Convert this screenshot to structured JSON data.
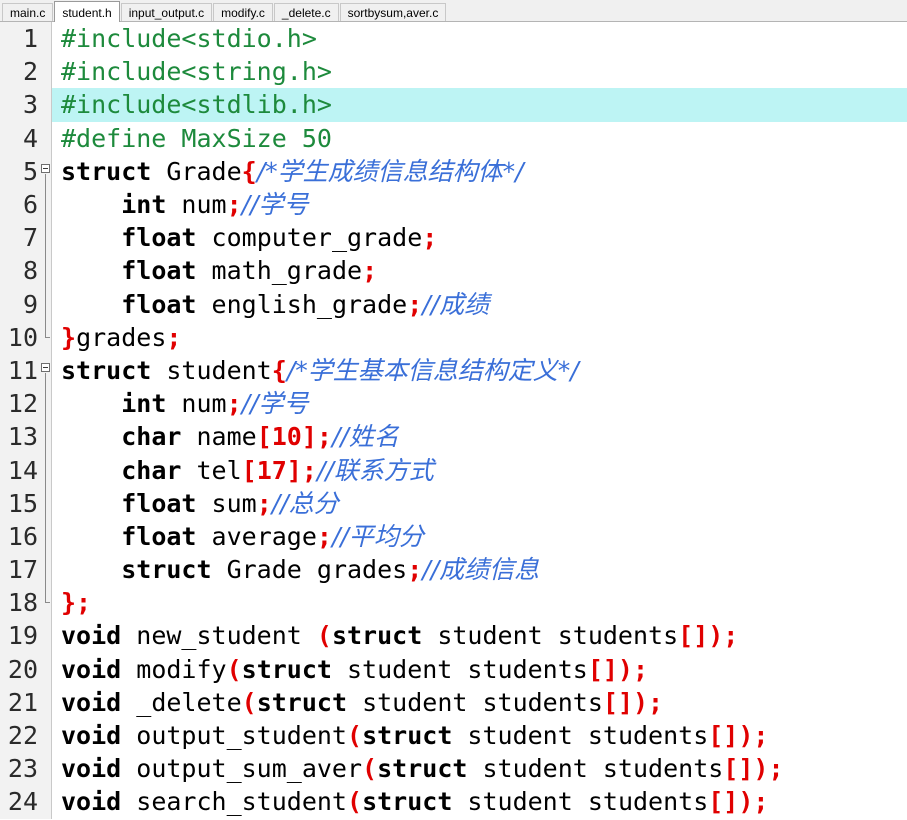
{
  "tabs": [
    {
      "label": "main.c",
      "active": false
    },
    {
      "label": "student.h",
      "active": true
    },
    {
      "label": "input_output.c",
      "active": false
    },
    {
      "label": "modify.c",
      "active": false
    },
    {
      "label": "_delete.c",
      "active": false
    },
    {
      "label": "sortbysum,aver.c",
      "active": false
    }
  ],
  "colors": {
    "preprocessor": "#1d8a3c",
    "keyword": "#000000",
    "punctuation": "#e00000",
    "comment": "#3a6fd8",
    "identifier": "#000000",
    "current_line_highlight": "#bdf4f4",
    "gutter_background": "#f2f2f2",
    "tabbar_background": "#f0f0f0",
    "editor_background": "#ffffff"
  },
  "editor": {
    "current_line": 3,
    "fold_regions": [
      {
        "start": 5,
        "end": 10
      },
      {
        "start": 11,
        "end": 18
      }
    ],
    "lines": [
      {
        "n": "1",
        "tokens": [
          {
            "t": "#include<stdio.h>",
            "c": "pp"
          }
        ]
      },
      {
        "n": "2",
        "tokens": [
          {
            "t": "#include<string.h>",
            "c": "pp"
          }
        ]
      },
      {
        "n": "3",
        "tokens": [
          {
            "t": "#include<stdlib.h>",
            "c": "pp"
          }
        ]
      },
      {
        "n": "4",
        "tokens": [
          {
            "t": "#define MaxSize 50",
            "c": "pp"
          }
        ]
      },
      {
        "n": "5",
        "tokens": [
          {
            "t": "struct",
            "c": "kw"
          },
          {
            "t": " Grade",
            "c": "id"
          },
          {
            "t": "{",
            "c": "pun"
          },
          {
            "t": "/*学生成绩信息结构体*/",
            "c": "cm cjk"
          }
        ]
      },
      {
        "n": "6",
        "tokens": [
          {
            "t": "    ",
            "c": "id"
          },
          {
            "t": "int",
            "c": "kw"
          },
          {
            "t": " num",
            "c": "id"
          },
          {
            "t": ";",
            "c": "pun"
          },
          {
            "t": "//学号",
            "c": "cm cjk"
          }
        ]
      },
      {
        "n": "7",
        "tokens": [
          {
            "t": "    ",
            "c": "id"
          },
          {
            "t": "float",
            "c": "kw"
          },
          {
            "t": " computer_grade",
            "c": "id"
          },
          {
            "t": ";",
            "c": "pun"
          }
        ]
      },
      {
        "n": "8",
        "tokens": [
          {
            "t": "    ",
            "c": "id"
          },
          {
            "t": "float",
            "c": "kw"
          },
          {
            "t": " math_grade",
            "c": "id"
          },
          {
            "t": ";",
            "c": "pun"
          }
        ]
      },
      {
        "n": "9",
        "tokens": [
          {
            "t": "    ",
            "c": "id"
          },
          {
            "t": "float",
            "c": "kw"
          },
          {
            "t": " english_grade",
            "c": "id"
          },
          {
            "t": ";",
            "c": "pun"
          },
          {
            "t": "//成绩",
            "c": "cm cjk"
          }
        ]
      },
      {
        "n": "10",
        "tokens": [
          {
            "t": "}",
            "c": "pun"
          },
          {
            "t": "grades",
            "c": "id"
          },
          {
            "t": ";",
            "c": "pun"
          }
        ]
      },
      {
        "n": "11",
        "tokens": [
          {
            "t": "struct",
            "c": "kw"
          },
          {
            "t": " student",
            "c": "id"
          },
          {
            "t": "{",
            "c": "pun"
          },
          {
            "t": "/*学生基本信息结构定义*/",
            "c": "cm cjk"
          }
        ]
      },
      {
        "n": "12",
        "tokens": [
          {
            "t": "    ",
            "c": "id"
          },
          {
            "t": "int",
            "c": "kw"
          },
          {
            "t": " num",
            "c": "id"
          },
          {
            "t": ";",
            "c": "pun"
          },
          {
            "t": "//学号",
            "c": "cm cjk"
          }
        ]
      },
      {
        "n": "13",
        "tokens": [
          {
            "t": "    ",
            "c": "id"
          },
          {
            "t": "char",
            "c": "kw"
          },
          {
            "t": " name",
            "c": "id"
          },
          {
            "t": "[10]",
            "c": "pun"
          },
          {
            "t": ";",
            "c": "pun"
          },
          {
            "t": "//姓名",
            "c": "cm cjk"
          }
        ]
      },
      {
        "n": "14",
        "tokens": [
          {
            "t": "    ",
            "c": "id"
          },
          {
            "t": "char",
            "c": "kw"
          },
          {
            "t": " tel",
            "c": "id"
          },
          {
            "t": "[17]",
            "c": "pun"
          },
          {
            "t": ";",
            "c": "pun"
          },
          {
            "t": "//联系方式",
            "c": "cm cjk"
          }
        ]
      },
      {
        "n": "15",
        "tokens": [
          {
            "t": "    ",
            "c": "id"
          },
          {
            "t": "float",
            "c": "kw"
          },
          {
            "t": " sum",
            "c": "id"
          },
          {
            "t": ";",
            "c": "pun"
          },
          {
            "t": "//总分",
            "c": "cm cjk"
          }
        ]
      },
      {
        "n": "16",
        "tokens": [
          {
            "t": "    ",
            "c": "id"
          },
          {
            "t": "float",
            "c": "kw"
          },
          {
            "t": " average",
            "c": "id"
          },
          {
            "t": ";",
            "c": "pun"
          },
          {
            "t": "//平均分",
            "c": "cm cjk"
          }
        ]
      },
      {
        "n": "17",
        "tokens": [
          {
            "t": "    ",
            "c": "id"
          },
          {
            "t": "struct",
            "c": "kw"
          },
          {
            "t": " Grade grades",
            "c": "id"
          },
          {
            "t": ";",
            "c": "pun"
          },
          {
            "t": "//成绩信息",
            "c": "cm cjk"
          }
        ]
      },
      {
        "n": "18",
        "tokens": [
          {
            "t": "};",
            "c": "pun"
          }
        ]
      },
      {
        "n": "19",
        "tokens": [
          {
            "t": "void",
            "c": "kw"
          },
          {
            "t": " new_student ",
            "c": "id"
          },
          {
            "t": "(",
            "c": "pun"
          },
          {
            "t": "struct",
            "c": "kw"
          },
          {
            "t": " student students",
            "c": "id"
          },
          {
            "t": "[]);",
            "c": "pun"
          }
        ]
      },
      {
        "n": "20",
        "tokens": [
          {
            "t": "void",
            "c": "kw"
          },
          {
            "t": " modify",
            "c": "id"
          },
          {
            "t": "(",
            "c": "pun"
          },
          {
            "t": "struct",
            "c": "kw"
          },
          {
            "t": " student students",
            "c": "id"
          },
          {
            "t": "[]);",
            "c": "pun"
          }
        ]
      },
      {
        "n": "21",
        "tokens": [
          {
            "t": "void",
            "c": "kw"
          },
          {
            "t": " _delete",
            "c": "id"
          },
          {
            "t": "(",
            "c": "pun"
          },
          {
            "t": "struct",
            "c": "kw"
          },
          {
            "t": " student students",
            "c": "id"
          },
          {
            "t": "[]);",
            "c": "pun"
          }
        ]
      },
      {
        "n": "22",
        "tokens": [
          {
            "t": "void",
            "c": "kw"
          },
          {
            "t": " output_student",
            "c": "id"
          },
          {
            "t": "(",
            "c": "pun"
          },
          {
            "t": "struct",
            "c": "kw"
          },
          {
            "t": " student students",
            "c": "id"
          },
          {
            "t": "[]);",
            "c": "pun"
          }
        ]
      },
      {
        "n": "23",
        "tokens": [
          {
            "t": "void",
            "c": "kw"
          },
          {
            "t": " output_sum_aver",
            "c": "id"
          },
          {
            "t": "(",
            "c": "pun"
          },
          {
            "t": "struct",
            "c": "kw"
          },
          {
            "t": " student students",
            "c": "id"
          },
          {
            "t": "[]);",
            "c": "pun"
          }
        ]
      },
      {
        "n": "24",
        "tokens": [
          {
            "t": "void",
            "c": "kw"
          },
          {
            "t": " search_student",
            "c": "id"
          },
          {
            "t": "(",
            "c": "pun"
          },
          {
            "t": "struct",
            "c": "kw"
          },
          {
            "t": " student students",
            "c": "id"
          },
          {
            "t": "[]);",
            "c": "pun"
          }
        ]
      }
    ]
  }
}
